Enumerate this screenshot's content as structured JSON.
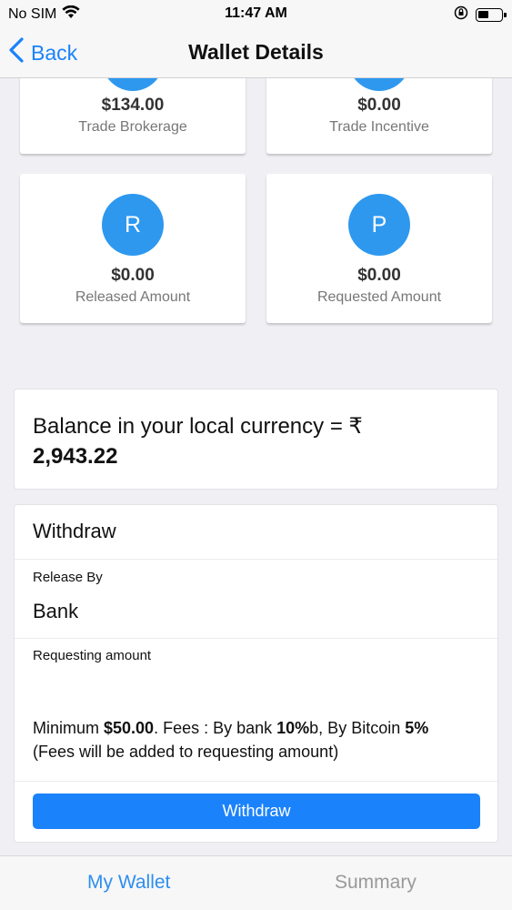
{
  "status_bar": {
    "carrier": "No SIM",
    "time": "11:47 AM"
  },
  "nav": {
    "back_label": "Back",
    "title": "Wallet Details"
  },
  "cards": [
    {
      "initial": "",
      "amount": "$134.00",
      "label": "Trade Brokerage"
    },
    {
      "initial": "",
      "amount": "$0.00",
      "label": "Trade Incentive"
    },
    {
      "initial": "R",
      "amount": "$0.00",
      "label": "Released Amount"
    },
    {
      "initial": "P",
      "amount": "$0.00",
      "label": "Requested Amount"
    }
  ],
  "balance": {
    "label": "Balance in your local currency = ₹",
    "value": "2,943.22"
  },
  "withdraw": {
    "title": "Withdraw",
    "release_by_label": "Release By",
    "release_by_value": "Bank",
    "requesting_amount_label": "Requesting amount",
    "requesting_amount_value": "",
    "info": {
      "minimum_prefix": "Minimum ",
      "minimum_value": "$50.00",
      "fees_prefix": ". Fees : By bank ",
      "bank_fee": "10%",
      "bitcoin_prefix": "b, By Bitcoin ",
      "bitcoin_fee": "5%",
      "note": "(Fees will be added to requesting amount)"
    },
    "button_label": "Withdraw"
  },
  "tabs": [
    {
      "label": "My Wallet",
      "active": true
    },
    {
      "label": "Summary",
      "active": false
    }
  ],
  "colors": {
    "accent": "#1a82fb",
    "avatar": "#2e98ef",
    "active_tab": "#2e8ef0",
    "inactive_tab": "#999999"
  }
}
